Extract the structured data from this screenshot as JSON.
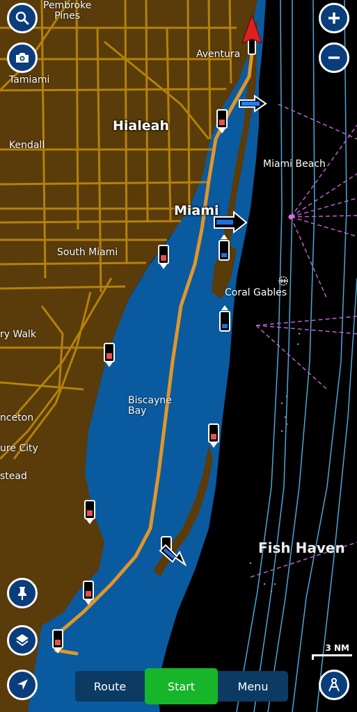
{
  "map": {
    "place_labels": [
      {
        "id": "pembroke-pines",
        "text": "Pembroke\nPines"
      },
      {
        "id": "tamiami",
        "text": "Tamiami"
      },
      {
        "id": "aventura",
        "text": "Aventura"
      },
      {
        "id": "hialeah",
        "text": "Hialeah"
      },
      {
        "id": "kendall",
        "text": "Kendall"
      },
      {
        "id": "miami-beach",
        "text": "Miami Beach"
      },
      {
        "id": "miami",
        "text": "Miami"
      },
      {
        "id": "south-miami",
        "text": "South Miami"
      },
      {
        "id": "coral-gables",
        "text": "Coral Gables"
      },
      {
        "id": "country-walk",
        "text": "ry Walk"
      },
      {
        "id": "biscayne-bay",
        "text": "Biscayne\nBay"
      },
      {
        "id": "princeton",
        "text": "nceton"
      },
      {
        "id": "leisure-city",
        "text": "ure City"
      },
      {
        "id": "homestead",
        "text": "stead"
      },
      {
        "id": "fish-haven",
        "text": "Fish Haven"
      }
    ],
    "colors": {
      "land": "#5a3b0a",
      "roads": "#b8860b",
      "shallow_water": "#0a5aa0",
      "deep_water": "#000000",
      "depth_contours": "#4aa8d8",
      "restricted_lines": "#c060d0",
      "route": "#e0962a"
    },
    "scale": "3 NM"
  },
  "controls": {
    "search": "search-icon",
    "camera": "camera-icon",
    "zoom_in": "plus-icon",
    "zoom_out": "minus-icon",
    "pin": "pushpin-icon",
    "layers": "layers-icon",
    "locate": "navigation-arrow-icon",
    "measure": "compass-divider-icon"
  },
  "bottom_bar": {
    "route_label": "Route",
    "start_label": "Start",
    "menu_label": "Menu",
    "start_color": "#17b52a"
  }
}
